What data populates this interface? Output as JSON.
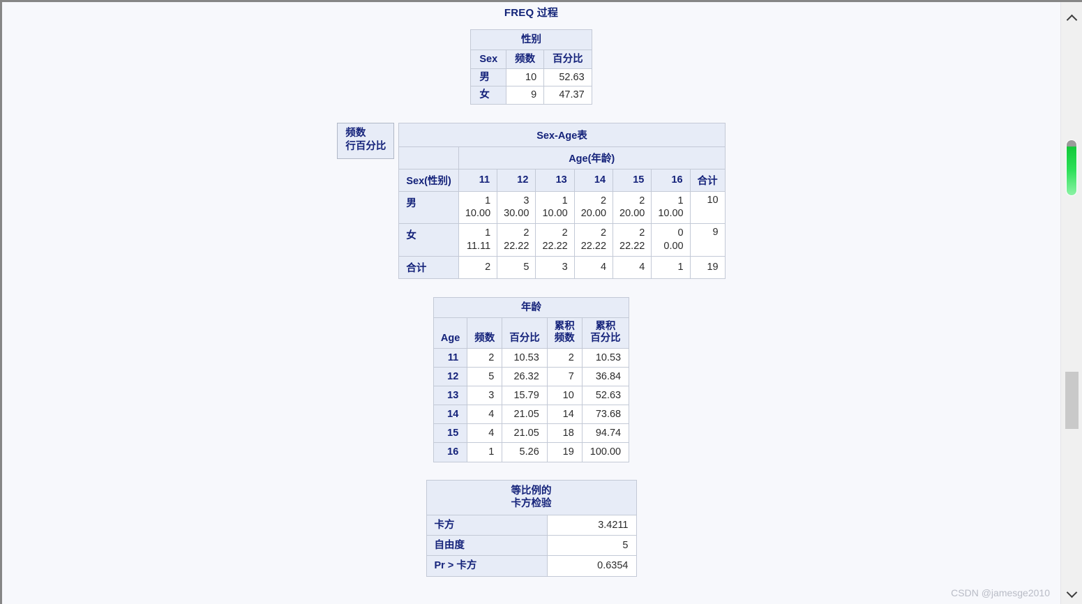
{
  "window": {
    "title": "FREQ 过程"
  },
  "watermark": "CSDN @jamesge2010",
  "colors": {
    "header_text": "#14227a",
    "header_bg": "#e7ecf7",
    "cell_bg": "#ffffff",
    "page_bg": "#f7f8fc",
    "border": "#c3c9d6",
    "scroll_marker": "#2fe05a"
  },
  "tables": {
    "sex_freq": {
      "title": "性别",
      "headers": [
        "Sex",
        "频数",
        "百分比"
      ],
      "rows": [
        {
          "label": "男",
          "freq": "10",
          "percent": "52.63"
        },
        {
          "label": "女",
          "freq": "9",
          "percent": "47.37"
        }
      ]
    },
    "crosstab": {
      "legend": [
        "频数",
        "行百分比"
      ],
      "title": "Sex-Age表",
      "group_header": "Age(年龄)",
      "stub_header": "Sex(性别)",
      "col_headers": [
        "11",
        "12",
        "13",
        "14",
        "15",
        "16"
      ],
      "total_header": "合计",
      "rows": [
        {
          "label": "男",
          "cells": [
            {
              "freq": "1",
              "rowpct": "10.00"
            },
            {
              "freq": "3",
              "rowpct": "30.00"
            },
            {
              "freq": "1",
              "rowpct": "10.00"
            },
            {
              "freq": "2",
              "rowpct": "20.00"
            },
            {
              "freq": "2",
              "rowpct": "20.00"
            },
            {
              "freq": "1",
              "rowpct": "10.00"
            }
          ],
          "total": "10"
        },
        {
          "label": "女",
          "cells": [
            {
              "freq": "1",
              "rowpct": "11.11"
            },
            {
              "freq": "2",
              "rowpct": "22.22"
            },
            {
              "freq": "2",
              "rowpct": "22.22"
            },
            {
              "freq": "2",
              "rowpct": "22.22"
            },
            {
              "freq": "2",
              "rowpct": "22.22"
            },
            {
              "freq": "0",
              "rowpct": "0.00"
            }
          ],
          "total": "9"
        }
      ],
      "footer": {
        "label": "合计",
        "cells": [
          "2",
          "5",
          "3",
          "4",
          "4",
          "1"
        ],
        "total": "19"
      }
    },
    "age_freq": {
      "title": "年龄",
      "headers": [
        "Age",
        "频数",
        "百分比",
        "累积\n频数",
        "累积\n百分比"
      ],
      "headers_split": [
        {
          "l1": "Age",
          "l2": ""
        },
        {
          "l1": "频数",
          "l2": ""
        },
        {
          "l1": "百分比",
          "l2": ""
        },
        {
          "l1": "累积",
          "l2": "频数"
        },
        {
          "l1": "累积",
          "l2": "百分比"
        }
      ],
      "rows": [
        {
          "age": "11",
          "freq": "2",
          "percent": "10.53",
          "cum_freq": "2",
          "cum_percent": "10.53"
        },
        {
          "age": "12",
          "freq": "5",
          "percent": "26.32",
          "cum_freq": "7",
          "cum_percent": "36.84"
        },
        {
          "age": "13",
          "freq": "3",
          "percent": "15.79",
          "cum_freq": "10",
          "cum_percent": "52.63"
        },
        {
          "age": "14",
          "freq": "4",
          "percent": "21.05",
          "cum_freq": "14",
          "cum_percent": "73.68"
        },
        {
          "age": "15",
          "freq": "4",
          "percent": "21.05",
          "cum_freq": "18",
          "cum_percent": "94.74"
        },
        {
          "age": "16",
          "freq": "1",
          "percent": "5.26",
          "cum_freq": "19",
          "cum_percent": "100.00"
        }
      ]
    },
    "chisq": {
      "title_line1": "等比例的",
      "title_line2": "卡方检验",
      "rows": [
        {
          "label": "卡方",
          "value": "3.4211"
        },
        {
          "label": "自由度",
          "value": "5"
        },
        {
          "label": "Pr > 卡方",
          "value": "0.6354"
        }
      ]
    }
  },
  "scrollbar": {
    "up_icon": "chevron-up-icon",
    "down_icon": "chevron-down-icon"
  }
}
